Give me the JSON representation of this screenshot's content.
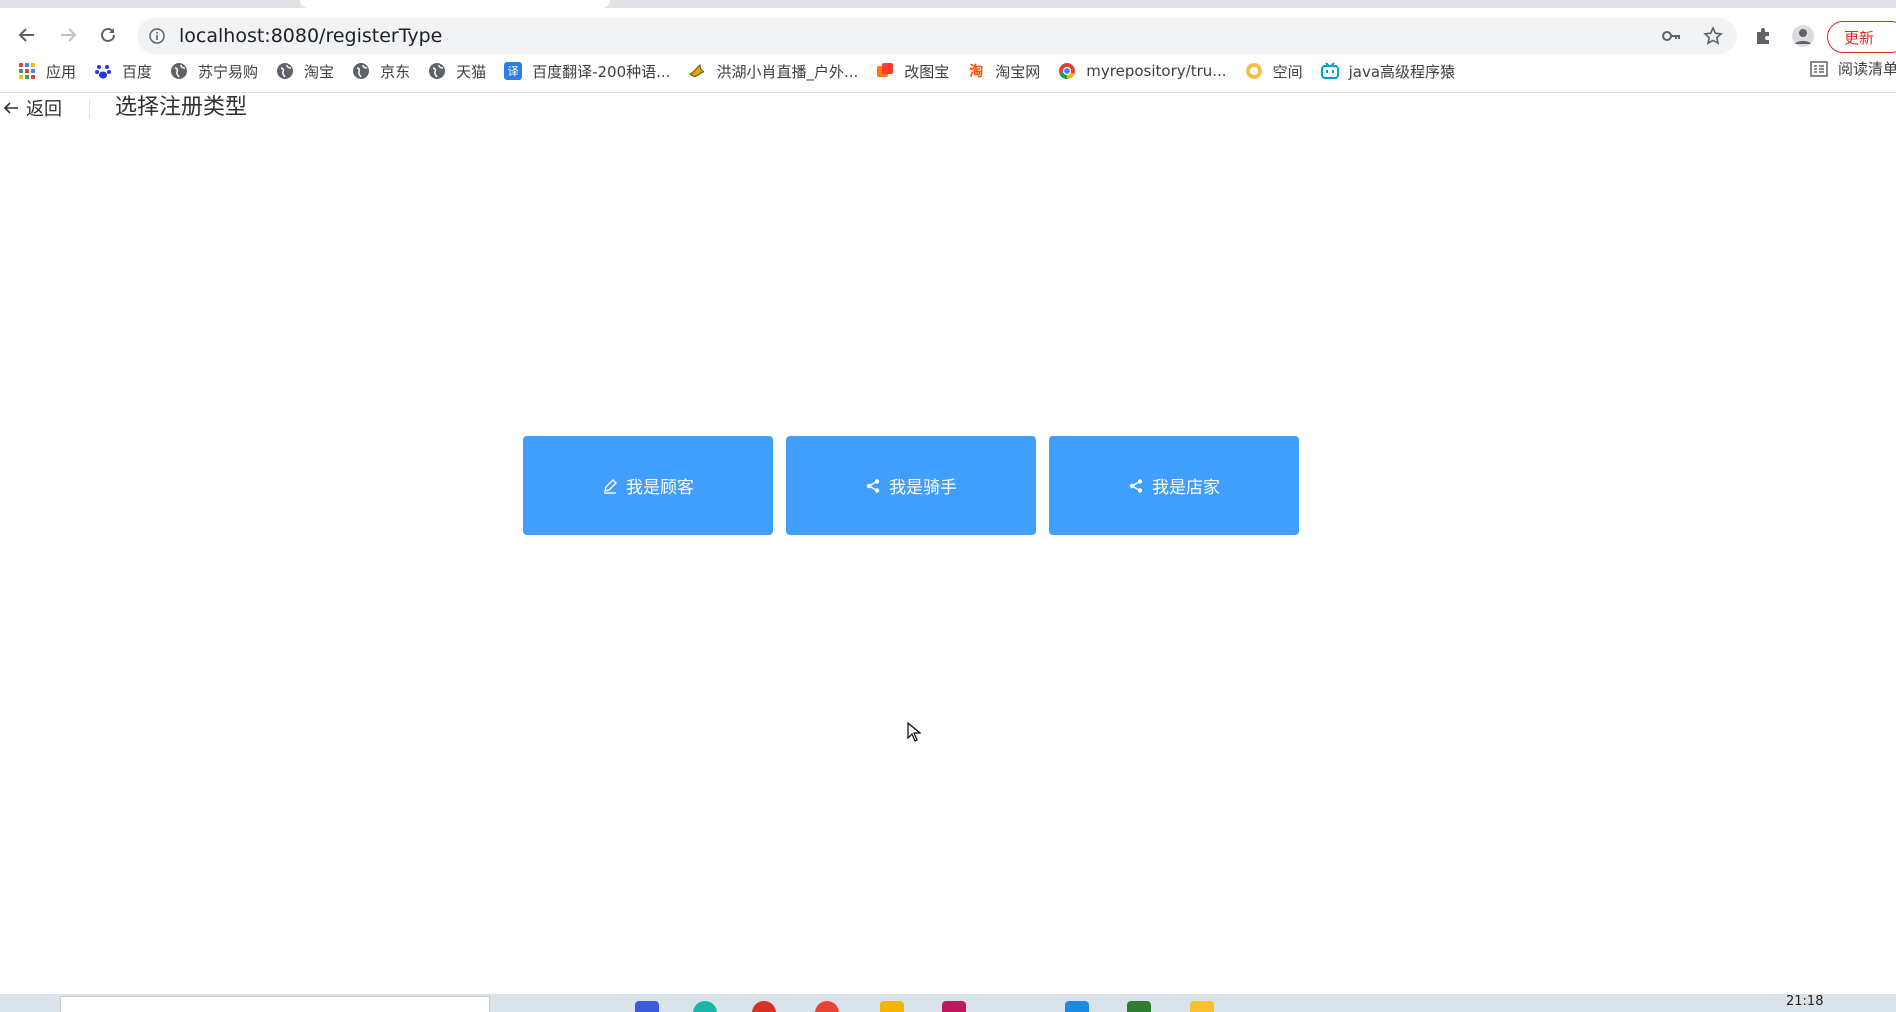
{
  "browser": {
    "url": "localhost:8080/registerType",
    "update_label": "更新",
    "bookmarks": [
      {
        "label": "应用",
        "icon": "apps-grid-icon"
      },
      {
        "label": "百度",
        "icon": "baidu-paw-icon"
      },
      {
        "label": "苏宁易购",
        "icon": "globe-icon"
      },
      {
        "label": "淘宝",
        "icon": "globe-icon"
      },
      {
        "label": "京东",
        "icon": "globe-icon"
      },
      {
        "label": "天猫",
        "icon": "globe-icon"
      },
      {
        "label": "百度翻译-200种语...",
        "icon": "translate-icon"
      },
      {
        "label": "洪湖小肖直播_户外...",
        "icon": "bird-icon"
      },
      {
        "label": "改图宝",
        "icon": "stack-icon"
      },
      {
        "label": "淘宝网",
        "icon": "taobao-icon"
      },
      {
        "label": "myrepository/tru...",
        "icon": "chrome-icon"
      },
      {
        "label": "空间",
        "icon": "qzone-icon"
      },
      {
        "label": "java高级程序猿",
        "icon": "bilibili-icon"
      }
    ],
    "reading_list_label": "阅读清单"
  },
  "page": {
    "back_label": "返回",
    "title": "选择注册类型",
    "buttons": [
      {
        "label": "我是顾客",
        "icon": "edit-icon"
      },
      {
        "label": "我是骑手",
        "icon": "share-icon"
      },
      {
        "label": "我是店家",
        "icon": "share-icon"
      }
    ]
  },
  "taskbar": {
    "clock": "21:18"
  },
  "colors": {
    "primary": "#409eff",
    "update_red": "#d93025"
  }
}
